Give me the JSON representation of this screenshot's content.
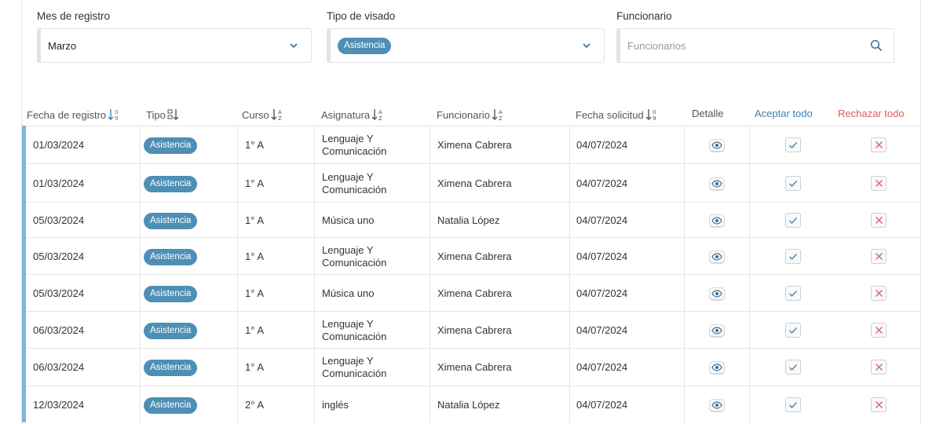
{
  "filters": {
    "month": {
      "label": "Mes de registro",
      "value": "Marzo"
    },
    "visa_type": {
      "label": "Tipo de visado",
      "chip": "Asistencia"
    },
    "official": {
      "label": "Funcionario",
      "placeholder": "Funcionarios"
    }
  },
  "table": {
    "headers": {
      "fecha_registro": "Fecha de registro",
      "tipo": "Tipo",
      "curso": "Curso",
      "asignatura": "Asignatura",
      "funcionario": "Funcionario",
      "fecha_solicitud": "Fecha solicitud",
      "detalle": "Detalle",
      "aceptar_todo": "Aceptar todo",
      "rechazar_todo": "Rechazar todo"
    },
    "rows": [
      {
        "fecha": "01/03/2024",
        "tipo": "Asistencia",
        "curso": "1° A",
        "asignatura_1": "Lenguaje Y",
        "asignatura_2": "Comunicación",
        "funcionario": "Ximena Cabrera",
        "solicitud": "04/07/2024"
      },
      {
        "fecha": "01/03/2024",
        "tipo": "Asistencia",
        "curso": "1° A",
        "asignatura_1": "Lenguaje Y",
        "asignatura_2": "Comunicación",
        "funcionario": "Ximena Cabrera",
        "solicitud": "04/07/2024"
      },
      {
        "fecha": "05/03/2024",
        "tipo": "Asistencia",
        "curso": "1° A",
        "asignatura_1": "Música uno",
        "asignatura_2": "",
        "funcionario": "Natalia López",
        "solicitud": "04/07/2024"
      },
      {
        "fecha": "05/03/2024",
        "tipo": "Asistencia",
        "curso": "1° A",
        "asignatura_1": "Lenguaje Y",
        "asignatura_2": "Comunicación",
        "funcionario": "Ximena Cabrera",
        "solicitud": "04/07/2024"
      },
      {
        "fecha": "05/03/2024",
        "tipo": "Asistencia",
        "curso": "1° A",
        "asignatura_1": "Música uno",
        "asignatura_2": "",
        "funcionario": "Ximena Cabrera",
        "solicitud": "04/07/2024"
      },
      {
        "fecha": "06/03/2024",
        "tipo": "Asistencia",
        "curso": "1° A",
        "asignatura_1": "Lenguaje Y",
        "asignatura_2": "Comunicación",
        "funcionario": "Ximena Cabrera",
        "solicitud": "04/07/2024"
      },
      {
        "fecha": "06/03/2024",
        "tipo": "Asistencia",
        "curso": "1° A",
        "asignatura_1": "Lenguaje Y",
        "asignatura_2": "Comunicación",
        "funcionario": "Ximena Cabrera",
        "solicitud": "04/07/2024"
      },
      {
        "fecha": "12/03/2024",
        "tipo": "Asistencia",
        "curso": "2° A",
        "asignatura_1": "inglés",
        "asignatura_2": "",
        "funcionario": "Natalia López",
        "solicitud": "04/07/2024"
      }
    ]
  },
  "icons": {
    "dropdown": "chevron-down-icon",
    "search": "search-icon",
    "sort_numeric": "sort-numeric-icon",
    "sort_alpha": "sort-alpha-icon",
    "detail": "eye-icon",
    "accept": "check-icon",
    "reject": "close-icon"
  },
  "colors": {
    "accent": "#7fb6d9",
    "chip": "#4d8fb5",
    "accept": "#3f7fad",
    "reject": "#d9605a"
  }
}
